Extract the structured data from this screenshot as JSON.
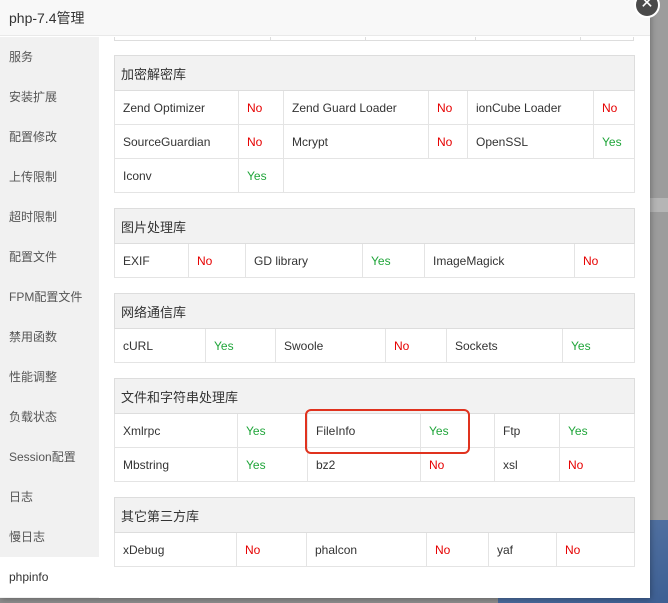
{
  "dialog": {
    "title": "php-7.4管理",
    "close_icon": "close-icon"
  },
  "sidebar": {
    "items": [
      {
        "label": "服务"
      },
      {
        "label": "安装扩展"
      },
      {
        "label": "配置修改"
      },
      {
        "label": "上传限制"
      },
      {
        "label": "超时限制"
      },
      {
        "label": "配置文件"
      },
      {
        "label": "FPM配置文件"
      },
      {
        "label": "禁用函数"
      },
      {
        "label": "性能调整"
      },
      {
        "label": "负载状态"
      },
      {
        "label": "Session配置"
      },
      {
        "label": "日志"
      },
      {
        "label": "慢日志"
      },
      {
        "label": "phpinfo",
        "active": true
      }
    ]
  },
  "sections": [
    {
      "title": "加密解密库",
      "rows": [
        [
          {
            "name": "Zend Optimizer",
            "status": "No"
          },
          {
            "name": "Zend Guard Loader",
            "status": "No"
          },
          {
            "name": "ionCube Loader",
            "status": "No"
          }
        ],
        [
          {
            "name": "SourceGuardian",
            "status": "No"
          },
          {
            "name": "Mcrypt",
            "status": "No"
          },
          {
            "name": "OpenSSL",
            "status": "Yes"
          }
        ],
        [
          {
            "name": "Iconv",
            "status": "Yes"
          }
        ]
      ]
    },
    {
      "title": "图片处理库",
      "rows": [
        [
          {
            "name": "EXIF",
            "status": "No"
          },
          {
            "name": "GD library",
            "status": "Yes"
          },
          {
            "name": "ImageMagick",
            "status": "No"
          }
        ]
      ]
    },
    {
      "title": "网络通信库",
      "rows": [
        [
          {
            "name": "cURL",
            "status": "Yes"
          },
          {
            "name": "Swoole",
            "status": "No"
          },
          {
            "name": "Sockets",
            "status": "Yes"
          }
        ]
      ]
    },
    {
      "title": "文件和字符串处理库",
      "rows": [
        [
          {
            "name": "Xmlrpc",
            "status": "Yes"
          },
          {
            "name": "FileInfo",
            "status": "Yes"
          },
          {
            "name": "Ftp",
            "status": "Yes"
          }
        ],
        [
          {
            "name": "Mbstring",
            "status": "Yes"
          },
          {
            "name": "bz2",
            "status": "No"
          },
          {
            "name": "xsl",
            "status": "No"
          }
        ]
      ]
    },
    {
      "title": "其它第三方库",
      "rows": [
        [
          {
            "name": "xDebug",
            "status": "No"
          },
          {
            "name": "phalcon",
            "status": "No"
          },
          {
            "name": "yaf",
            "status": "No"
          }
        ]
      ]
    }
  ],
  "colors": {
    "yes": "#20a53a",
    "no": "#e60000",
    "highlight": "#e0321e"
  }
}
